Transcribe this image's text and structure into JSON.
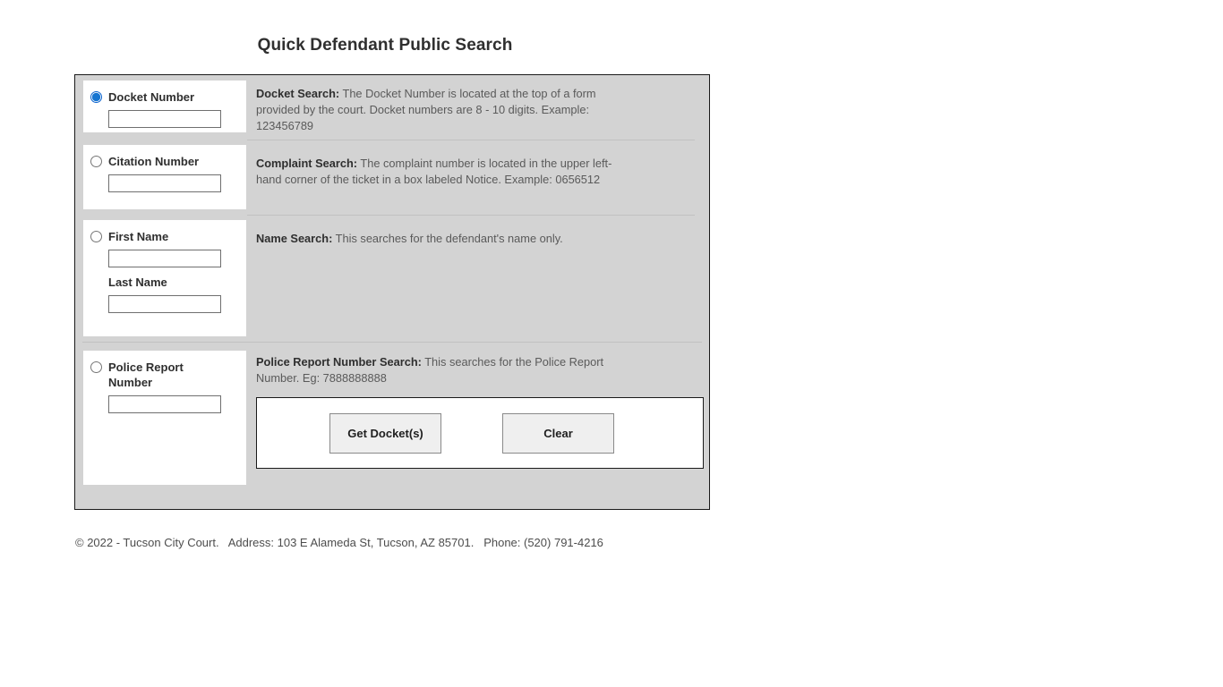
{
  "page": {
    "title": "Quick Defendant Public Search"
  },
  "options": [
    {
      "key": "docket",
      "label": "Docket Number",
      "selected": true,
      "radio_name": "search-type",
      "input_value": "",
      "input_placeholder": "",
      "description_title": "Docket Search:",
      "description_body": " The Docket Number is located at the top of a form provided by the court. Docket numbers are 8 - 10 digits. Example: 123456789"
    },
    {
      "key": "citation",
      "label": "Citation Number",
      "selected": false,
      "radio_name": "search-type",
      "input_value": "",
      "input_placeholder": "",
      "description_title": "Complaint Search:",
      "description_body": " The complaint number is located in the upper left-hand corner of the ticket in a box labeled Notice. Example: 0656512"
    },
    {
      "key": "name",
      "label": "First Name",
      "sub_label": "Last Name",
      "selected": false,
      "radio_name": "search-type",
      "input_value": "",
      "input_placeholder": "",
      "sub_input_value": "",
      "sub_input_placeholder": "",
      "description_title": "Name Search:",
      "description_body": " This searches for the defendant's name only."
    },
    {
      "key": "police",
      "label": "Police Report Number",
      "selected": false,
      "radio_name": "search-type",
      "input_value": "",
      "input_placeholder": "",
      "description_title": "Police Report Number Search:",
      "description_body": " This searches for the Police Report Number. Eg: 7888888888"
    }
  ],
  "actions": {
    "submit_label": "Get Docket(s)",
    "clear_label": "Clear"
  },
  "footer": {
    "copyright": "© 2022 - Tucson City Court.",
    "address": "Address: 103 E Alameda St, Tucson, AZ 85701.",
    "phone": "Phone: (520) 791-4216"
  },
  "colors": {
    "panel_background": "#d3d3d3",
    "card_background": "#ffffff",
    "radio_accent": "#1675d1",
    "text_primary": "#2f2f2f",
    "text_secondary": "#5a5a5a",
    "button_background": "#efefef"
  }
}
